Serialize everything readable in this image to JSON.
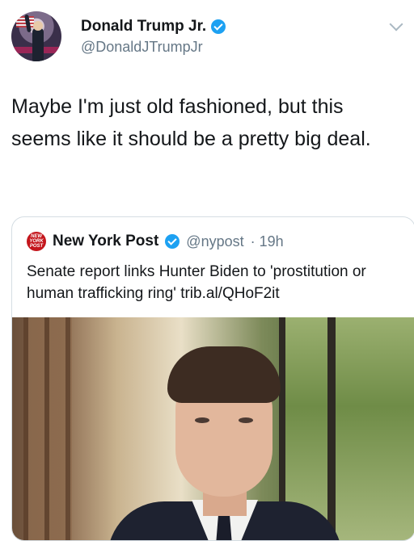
{
  "author": {
    "name": "Donald Trump Jr.",
    "handle": "@DonaldJTrumpJr",
    "verified": true,
    "avatar_icon": "avatar-photo"
  },
  "tweet": {
    "text": "Maybe I'm just old fashioned, but this seems like it should be a pretty big deal."
  },
  "quoted": {
    "name": "New York Post",
    "verified": true,
    "handle": "@nypost",
    "meta": "· 19h",
    "logo_text": "NEW YORK POST",
    "text": "Senate report links Hunter Biden to 'prostitution or human trafficking ring' trib.al/QHoF2it"
  },
  "colors": {
    "verified": "#1da1f2",
    "nypost_red": "#c4161c",
    "secondary_text": "#657786"
  }
}
